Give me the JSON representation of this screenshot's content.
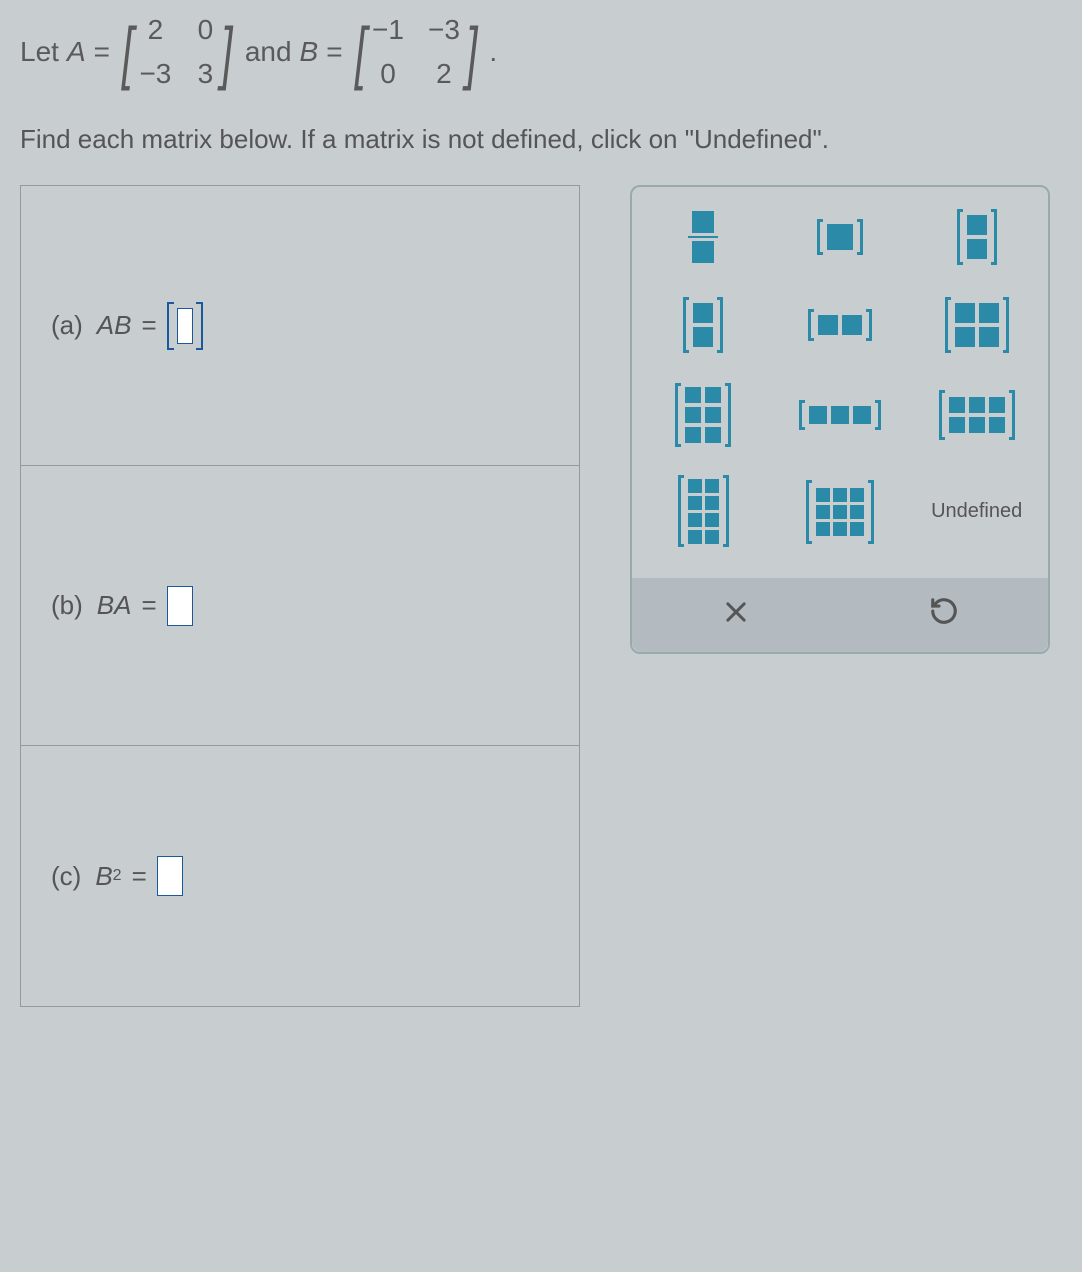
{
  "problem": {
    "let": "Let",
    "varA": "A",
    "eq": "=",
    "matrixA": {
      "r0c0": "2",
      "r0c1": "0",
      "r1c0": "−3",
      "r1c1": "3"
    },
    "and": "and",
    "varB": "B",
    "matrixB": {
      "r0c0": "−1",
      "r0c1": "−3",
      "r1c0": "0",
      "r1c1": "2"
    },
    "period": "."
  },
  "instruction": "Find each matrix below. If a matrix is not defined, click on \"Undefined\".",
  "parts": {
    "a": {
      "label": "(a)",
      "expr_left": "A",
      "expr_mid": "B",
      "eq": "="
    },
    "b": {
      "label": "(b)",
      "expr_left": "B",
      "expr_mid": "A",
      "eq": "="
    },
    "c": {
      "label": "(c)",
      "expr_left": "B",
      "sup": "2",
      "eq": "="
    }
  },
  "palette": {
    "fraction": "fraction",
    "m1x1": "1x1",
    "m2x1": "2x1",
    "m2x1b": "2x1",
    "m1x2": "1x2",
    "m2x2": "2x2",
    "m3x2": "3x2",
    "m1x3": "1x3",
    "m2x3": "2x3",
    "m4x2": "4x2",
    "m3x3": "3x3",
    "undefined": "Undefined",
    "clear": "×",
    "reset": "↺"
  }
}
